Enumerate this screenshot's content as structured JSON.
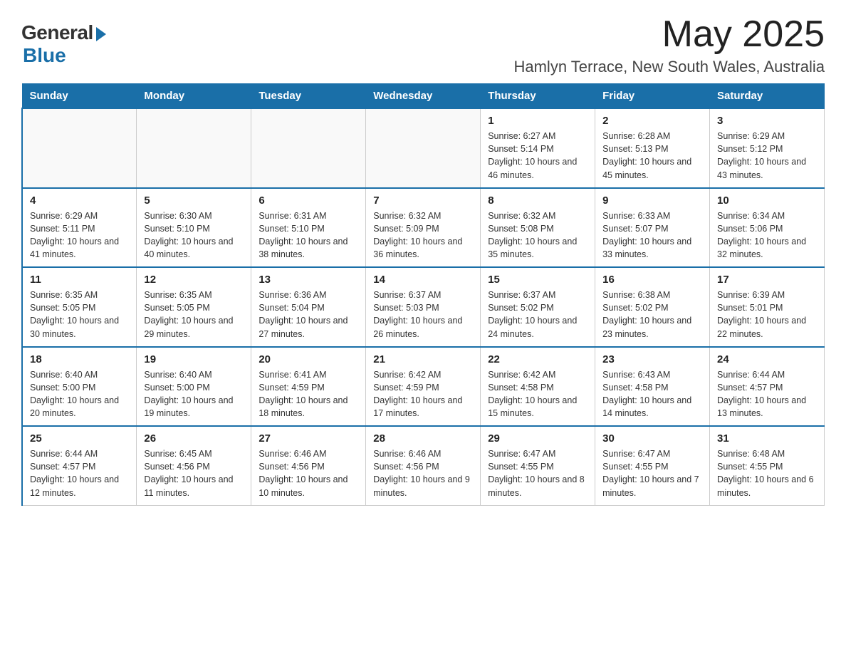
{
  "logo": {
    "general": "General",
    "blue": "Blue"
  },
  "title": {
    "month_year": "May 2025",
    "location": "Hamlyn Terrace, New South Wales, Australia"
  },
  "days_of_week": [
    "Sunday",
    "Monday",
    "Tuesday",
    "Wednesday",
    "Thursday",
    "Friday",
    "Saturday"
  ],
  "weeks": [
    [
      {
        "day": "",
        "info": ""
      },
      {
        "day": "",
        "info": ""
      },
      {
        "day": "",
        "info": ""
      },
      {
        "day": "",
        "info": ""
      },
      {
        "day": "1",
        "info": "Sunrise: 6:27 AM\nSunset: 5:14 PM\nDaylight: 10 hours and 46 minutes."
      },
      {
        "day": "2",
        "info": "Sunrise: 6:28 AM\nSunset: 5:13 PM\nDaylight: 10 hours and 45 minutes."
      },
      {
        "day": "3",
        "info": "Sunrise: 6:29 AM\nSunset: 5:12 PM\nDaylight: 10 hours and 43 minutes."
      }
    ],
    [
      {
        "day": "4",
        "info": "Sunrise: 6:29 AM\nSunset: 5:11 PM\nDaylight: 10 hours and 41 minutes."
      },
      {
        "day": "5",
        "info": "Sunrise: 6:30 AM\nSunset: 5:10 PM\nDaylight: 10 hours and 40 minutes."
      },
      {
        "day": "6",
        "info": "Sunrise: 6:31 AM\nSunset: 5:10 PM\nDaylight: 10 hours and 38 minutes."
      },
      {
        "day": "7",
        "info": "Sunrise: 6:32 AM\nSunset: 5:09 PM\nDaylight: 10 hours and 36 minutes."
      },
      {
        "day": "8",
        "info": "Sunrise: 6:32 AM\nSunset: 5:08 PM\nDaylight: 10 hours and 35 minutes."
      },
      {
        "day": "9",
        "info": "Sunrise: 6:33 AM\nSunset: 5:07 PM\nDaylight: 10 hours and 33 minutes."
      },
      {
        "day": "10",
        "info": "Sunrise: 6:34 AM\nSunset: 5:06 PM\nDaylight: 10 hours and 32 minutes."
      }
    ],
    [
      {
        "day": "11",
        "info": "Sunrise: 6:35 AM\nSunset: 5:05 PM\nDaylight: 10 hours and 30 minutes."
      },
      {
        "day": "12",
        "info": "Sunrise: 6:35 AM\nSunset: 5:05 PM\nDaylight: 10 hours and 29 minutes."
      },
      {
        "day": "13",
        "info": "Sunrise: 6:36 AM\nSunset: 5:04 PM\nDaylight: 10 hours and 27 minutes."
      },
      {
        "day": "14",
        "info": "Sunrise: 6:37 AM\nSunset: 5:03 PM\nDaylight: 10 hours and 26 minutes."
      },
      {
        "day": "15",
        "info": "Sunrise: 6:37 AM\nSunset: 5:02 PM\nDaylight: 10 hours and 24 minutes."
      },
      {
        "day": "16",
        "info": "Sunrise: 6:38 AM\nSunset: 5:02 PM\nDaylight: 10 hours and 23 minutes."
      },
      {
        "day": "17",
        "info": "Sunrise: 6:39 AM\nSunset: 5:01 PM\nDaylight: 10 hours and 22 minutes."
      }
    ],
    [
      {
        "day": "18",
        "info": "Sunrise: 6:40 AM\nSunset: 5:00 PM\nDaylight: 10 hours and 20 minutes."
      },
      {
        "day": "19",
        "info": "Sunrise: 6:40 AM\nSunset: 5:00 PM\nDaylight: 10 hours and 19 minutes."
      },
      {
        "day": "20",
        "info": "Sunrise: 6:41 AM\nSunset: 4:59 PM\nDaylight: 10 hours and 18 minutes."
      },
      {
        "day": "21",
        "info": "Sunrise: 6:42 AM\nSunset: 4:59 PM\nDaylight: 10 hours and 17 minutes."
      },
      {
        "day": "22",
        "info": "Sunrise: 6:42 AM\nSunset: 4:58 PM\nDaylight: 10 hours and 15 minutes."
      },
      {
        "day": "23",
        "info": "Sunrise: 6:43 AM\nSunset: 4:58 PM\nDaylight: 10 hours and 14 minutes."
      },
      {
        "day": "24",
        "info": "Sunrise: 6:44 AM\nSunset: 4:57 PM\nDaylight: 10 hours and 13 minutes."
      }
    ],
    [
      {
        "day": "25",
        "info": "Sunrise: 6:44 AM\nSunset: 4:57 PM\nDaylight: 10 hours and 12 minutes."
      },
      {
        "day": "26",
        "info": "Sunrise: 6:45 AM\nSunset: 4:56 PM\nDaylight: 10 hours and 11 minutes."
      },
      {
        "day": "27",
        "info": "Sunrise: 6:46 AM\nSunset: 4:56 PM\nDaylight: 10 hours and 10 minutes."
      },
      {
        "day": "28",
        "info": "Sunrise: 6:46 AM\nSunset: 4:56 PM\nDaylight: 10 hours and 9 minutes."
      },
      {
        "day": "29",
        "info": "Sunrise: 6:47 AM\nSunset: 4:55 PM\nDaylight: 10 hours and 8 minutes."
      },
      {
        "day": "30",
        "info": "Sunrise: 6:47 AM\nSunset: 4:55 PM\nDaylight: 10 hours and 7 minutes."
      },
      {
        "day": "31",
        "info": "Sunrise: 6:48 AM\nSunset: 4:55 PM\nDaylight: 10 hours and 6 minutes."
      }
    ]
  ]
}
